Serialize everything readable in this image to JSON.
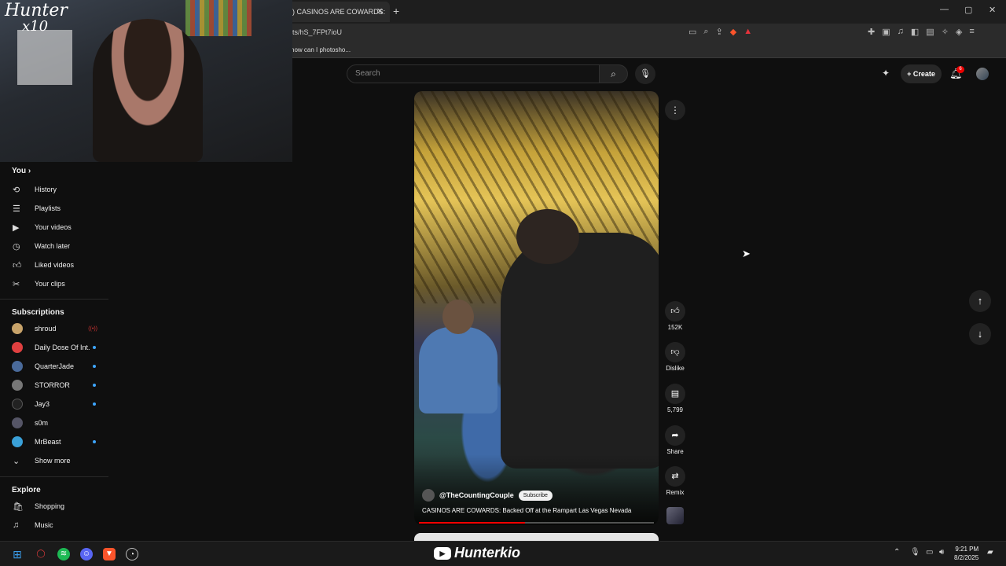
{
  "browser": {
    "tab_title": ") CASINOS ARE COWARDS:",
    "tab_close": "✕",
    "new_tab": "+",
    "url": "ts/hS_7FPt7ioU",
    "bookmark": "how can I photosho...",
    "window_controls": [
      "—",
      "▢",
      "✕"
    ]
  },
  "webcam": {
    "overlay_logo": "Hunter",
    "overlay_sub": "x10"
  },
  "header": {
    "search_placeholder": "Search",
    "create_label": "Create",
    "notification_count": "6"
  },
  "sidebar": {
    "you_heading": "You",
    "you_items": [
      {
        "label": "History",
        "icon": "history-icon"
      },
      {
        "label": "Playlists",
        "icon": "playlists-icon"
      },
      {
        "label": "Your videos",
        "icon": "your-videos-icon"
      },
      {
        "label": "Watch later",
        "icon": "watch-later-icon"
      },
      {
        "label": "Liked videos",
        "icon": "liked-videos-icon"
      },
      {
        "label": "Your clips",
        "icon": "clips-icon"
      }
    ],
    "subscriptions_heading": "Subscriptions",
    "subscriptions": [
      {
        "name": "shroud",
        "color": "#c8a36a",
        "status": "live"
      },
      {
        "name": "Daily Dose Of Int...",
        "color": "#e04040",
        "status": "new"
      },
      {
        "name": "QuarterJade",
        "color": "#4a6a9a",
        "status": "new"
      },
      {
        "name": "STORROR",
        "color": "#777777",
        "status": "new"
      },
      {
        "name": "Jay3",
        "color": "#222222",
        "status": "new"
      },
      {
        "name": "s0m",
        "color": "#555566",
        "status": "none"
      },
      {
        "name": "MrBeast",
        "color": "#3aa0d8",
        "status": "new"
      }
    ],
    "show_more": "Show more",
    "explore_heading": "Explore",
    "explore_items": [
      {
        "label": "Shopping",
        "icon": "shopping-icon"
      },
      {
        "label": "Music",
        "icon": "music-icon"
      }
    ]
  },
  "short": {
    "channel": "@TheCountingCouple",
    "subscribe_label": "Subscribe",
    "title": "CASINOS ARE COWARDS: Backed Off at the Rampart Las Vegas Nevada",
    "progress": 0.45
  },
  "actions": {
    "likes": "152K",
    "dislike": "Dislike",
    "comments": "5,799",
    "share": "Share",
    "remix": "Remix"
  },
  "taskbar": {
    "brand": "Hunterkio",
    "time": "9:21 PM",
    "date": "8/2/2025"
  },
  "colors": {
    "background": "#0f0f0f",
    "accent_red": "#ff0000",
    "live_dot": "#3ea6ff"
  }
}
